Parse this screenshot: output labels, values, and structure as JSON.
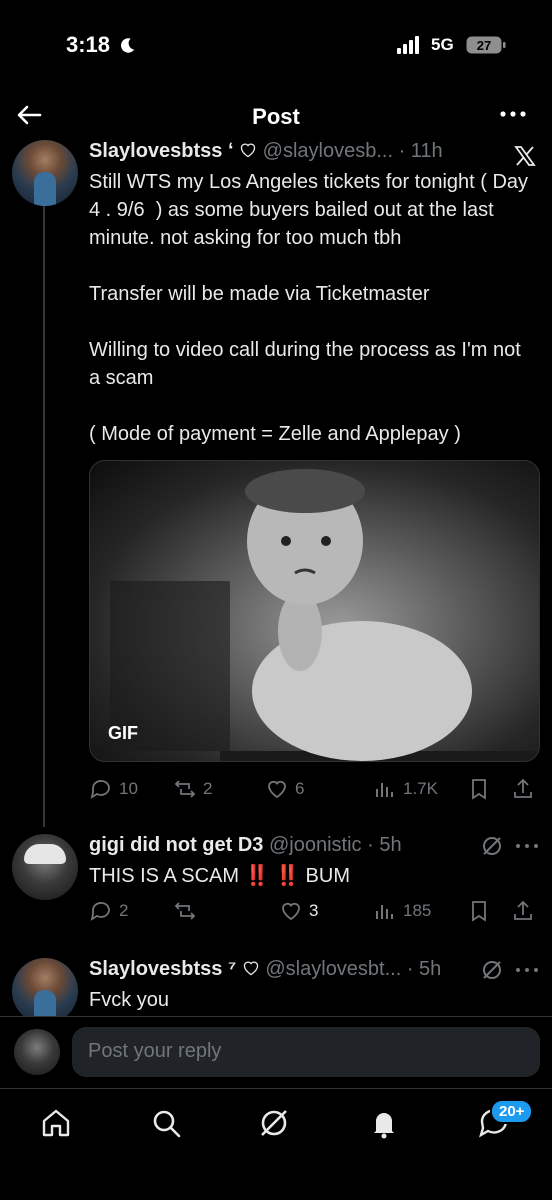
{
  "status_bar": {
    "time": "3:18",
    "network": "5G",
    "battery": "27"
  },
  "header": {
    "title": "Post"
  },
  "main_post": {
    "display_name": "Slaylovesbtss",
    "badge_mark": "ʻ",
    "handle_time": "@slaylovesb... · 11h",
    "paragraphs": [
      "Still WTS my Los Angeles tickets for tonight ( Day 4 . 9/6  ) as some buyers bailed out at the last minute. not asking for too much tbh",
      "Transfer will be made via Ticketmaster",
      "Willing to video call during the process as I'm not a scam",
      "( Mode of payment = Zelle and Applepay )"
    ],
    "media_badge": "GIF",
    "actions": {
      "replies": "10",
      "reposts": "2",
      "likes": "6",
      "views": "1.7K"
    }
  },
  "reply_1": {
    "display_name": "gigi did not get D3",
    "handle_time": "@joonistic · 5h",
    "text_before": "THIS IS A SCAM ",
    "emoji": "‼️ ‼️",
    "text_after": " BUM",
    "actions": {
      "replies": "2",
      "reposts": "",
      "likes": "3",
      "views": "185"
    }
  },
  "reply_2": {
    "display_name": "Slaylovesbtss",
    "badge_mark": "⁷",
    "handle_time": "@slaylovesbt... · 5h",
    "text": "Fvck you"
  },
  "composer": {
    "placeholder": "Post your reply"
  },
  "tabbar": {
    "notifications_badge": "20+"
  },
  "colors": {
    "accent": "#1d9bf0",
    "muted": "#71767b",
    "alert": "#f4212e"
  }
}
